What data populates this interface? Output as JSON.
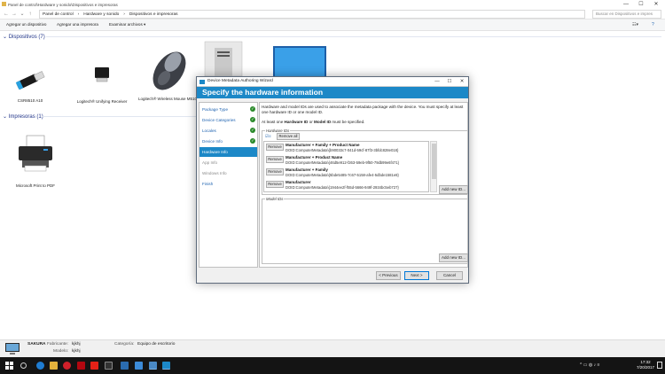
{
  "explorer": {
    "title": "Panel de control\\Hardware y sonido\\Dispositivos e impresoras",
    "breadcrumb": [
      "Panel de control",
      "Hardware y sonido",
      "Dispositivos e impresoras"
    ],
    "search_placeholder": "Buscar en Dispositivos e impres",
    "toolbar": [
      "Agregar un dispositivo",
      "Agregar una impresora",
      "Examinar archivos ▾"
    ],
    "sections": {
      "devices": "Dispositivos (7)",
      "printers": "Impresoras (1)"
    },
    "devices": [
      {
        "name": "CSR8510 A10",
        "icon": "usb-dongle-icon"
      },
      {
        "name": "Logitech® Unifying Receiver",
        "icon": "usb-receiver-icon"
      },
      {
        "name": "Logitech® Wireless Mouse M510",
        "icon": "mouse-icon"
      },
      {
        "name": "",
        "icon": "computer-tower-icon"
      },
      {
        "name": "",
        "icon": "monitor-icon"
      }
    ],
    "printers": [
      {
        "name": "Microsoft Print to PDF",
        "icon": "printer-icon"
      }
    ]
  },
  "wizard": {
    "title": "Device Metadata Authoring Wizard",
    "header": "Specify the hardware information",
    "steps": [
      {
        "label": "Package Type",
        "done": true,
        "state": "normal"
      },
      {
        "label": "Device Categories",
        "done": true,
        "state": "normal"
      },
      {
        "label": "Locales",
        "done": true,
        "state": "normal"
      },
      {
        "label": "Device Info",
        "done": true,
        "state": "normal"
      },
      {
        "label": "Hardware Info",
        "done": false,
        "state": "active"
      },
      {
        "label": "App Info",
        "done": false,
        "state": "disabled"
      },
      {
        "label": "Windows Info",
        "done": false,
        "state": "disabled"
      },
      {
        "label": "Finish",
        "done": false,
        "state": "normal"
      }
    ],
    "description": "Hardware and model IDs are used to associate the metadata package with the device. You must specify at least one hardware ID or one model ID.",
    "requirement_pre": "At least one ",
    "requirement_hw": "Hardware ID",
    "requirement_mid": " or ",
    "requirement_model": "Model ID",
    "requirement_post": " must be specified.",
    "hardware_group_label": "Hardware IDs",
    "model_group_label": "Model IDs",
    "remove_all": "Remove all",
    "remove": "Remove",
    "add_new": "Add new ID...",
    "hardware_ids": [
      {
        "name": "Manufacturer + Family + Product Name",
        "id": "DOID:ComputerMetadata\\{b90033c7-041d-59cf-87f3-3bfdc828e018}"
      },
      {
        "name": "Manufacturer + Product Name",
        "id": "DOID:ComputerMetadata\\{46d5e912-f263-59eb-9f50-79db99e6f471}"
      },
      {
        "name": "Manufacturer + Family",
        "id": "DOID:ComputerMetadata\\{5bde5485-7c67-5158-afe4-5dbde1581e8}"
      },
      {
        "name": "Manufacturer",
        "id": "DOID:ComputerMetadata\\{1944ee2f-f55d-5666-949f-2934bc5eb727}"
      }
    ],
    "buttons": {
      "previous": "< Previous",
      "next": "Next >",
      "cancel": "Cancel"
    }
  },
  "statusbar": {
    "computer_name": "SAKURA",
    "fabricante_label": "Fabricante:",
    "fabricante_value": "kjkhj",
    "modelo_label": "Modelo:",
    "modelo_value": "kjkhj",
    "categoria_label": "Categoría:",
    "categoria_value": "Equipo de escritorio"
  },
  "taskbar": {
    "time": "17:32",
    "date": "7/20/2017"
  }
}
